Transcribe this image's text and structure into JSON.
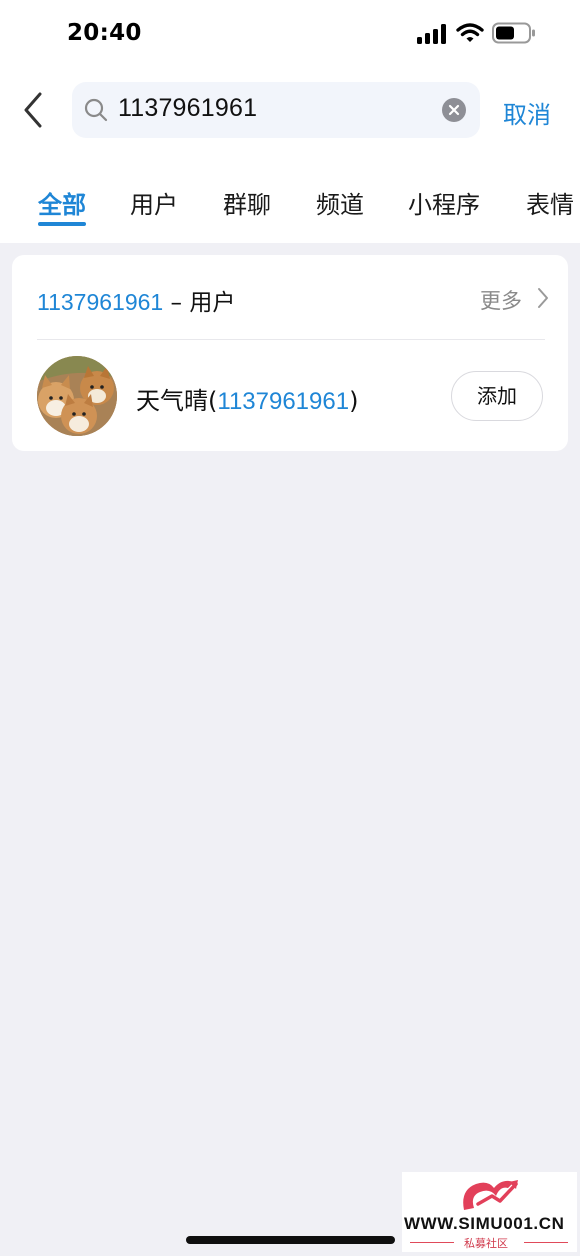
{
  "status_bar": {
    "time": "20:40"
  },
  "search": {
    "query": "1137961961",
    "cancel_label": "取消"
  },
  "tabs": [
    {
      "label": "全部",
      "active": true
    },
    {
      "label": "用户",
      "active": false
    },
    {
      "label": "群聊",
      "active": false
    },
    {
      "label": "频道",
      "active": false
    },
    {
      "label": "小程序",
      "active": false
    },
    {
      "label": "表情",
      "active": false
    }
  ],
  "result_section": {
    "title_number": "1137961961",
    "title_suffix": " – 用户",
    "more_label": "更多"
  },
  "result_user": {
    "name": "天气晴",
    "id_open": "(",
    "id": "1137961961",
    "id_close": ")",
    "add_label": "添加"
  },
  "watermark": {
    "text": "WWW.SIMU001.CN",
    "subtitle": "私募社区"
  },
  "colors": {
    "accent": "#1f86d6",
    "background": "#f0f0f5",
    "card": "#ffffff",
    "muted": "#8a8a8a"
  }
}
